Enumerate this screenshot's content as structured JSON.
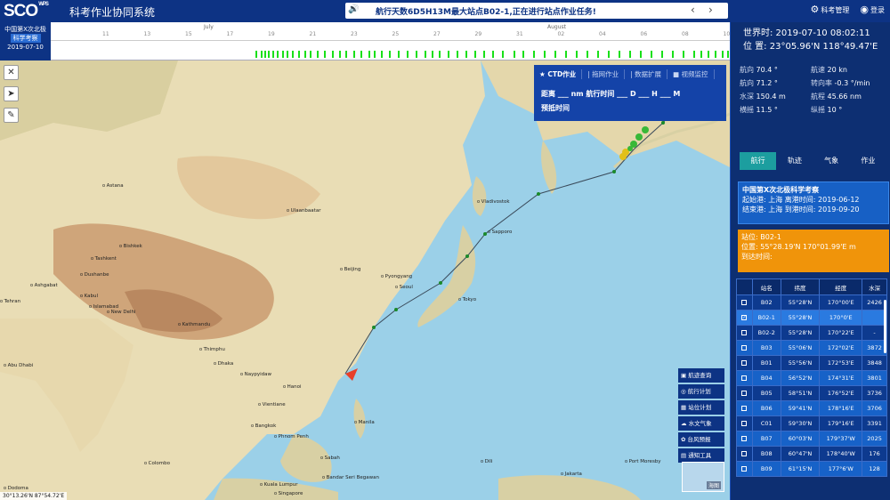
{
  "header": {
    "logo": "SCO",
    "logo_sup": "WPS",
    "app_title": "科考作业协同系统",
    "notice": "航行天数6D5H13M最大站点B02-1,正在进行站点作业任务!",
    "user_mgmt": "科考管理",
    "user": "登录"
  },
  "mission": {
    "line1": "中国第X次北极",
    "line2": "科学考察",
    "date": "2019-07-10"
  },
  "timeline": {
    "months": [
      "July",
      "August"
    ],
    "ticks": [
      "11",
      "13",
      "15",
      "17",
      "19",
      "21",
      "23",
      "25",
      "27",
      "29",
      "31",
      "02",
      "04",
      "06",
      "08",
      "10"
    ]
  },
  "popup": {
    "tabs": [
      "★ CTD作业",
      "| 拖网作业",
      "| 数据扩展",
      "■ 视频监控"
    ],
    "row1": "距离 ___ nm   航行时间 ___ D ___ H ___ M",
    "row2": "预抵时间"
  },
  "map": {
    "coord": "30°13.26'N  87°54.72'E",
    "cities": [
      "Astana",
      "Ulaanbaatar",
      "Bishkek",
      "Tashkent",
      "Dushanbe",
      "Ashgabat",
      "Tehran",
      "Kabul",
      "Islamabad",
      "New Delhi",
      "Kathmandu",
      "Dhaka",
      "Thimphu",
      "Naypyidaw",
      "Hanoi",
      "Vientiane",
      "Bangkok",
      "Phnom Penh",
      "Manila",
      "Colombo",
      "Kuala Lumpur",
      "Singapore",
      "Bandar Seri Begawan",
      "Beijing",
      "Seoul",
      "Tokyo",
      "Pyongyang",
      "Abu Dhabi",
      "Dodoma",
      "Jakarta",
      "Dili",
      "Port Moresby",
      "Sabah",
      "Vladivostok",
      "Sapporo"
    ],
    "actions": [
      "航迹查询",
      "航行计划",
      "站位计划",
      "水文气象",
      "台风预报",
      "通知工具"
    ],
    "minimap_label": "海图"
  },
  "sidebar": {
    "time": "世界时: 2019-07-10 08:02:11",
    "pos": "位  置: 23°05.96'N  118°49.47'E",
    "stats": [
      {
        "label": "航向",
        "value": "70.4 °"
      },
      {
        "label": "航速",
        "value": "20 kn"
      },
      {
        "label": "航向",
        "value": "71.2 °"
      },
      {
        "label": "转向率",
        "value": "-0.3 °/min"
      },
      {
        "label": "水深",
        "value": "150.4 m"
      },
      {
        "label": "航程",
        "value": "45.66 nm"
      },
      {
        "label": "横摇",
        "value": "11.5 °"
      },
      {
        "label": "纵摇",
        "value": "10 °"
      }
    ],
    "tabs": [
      "航行",
      "轨迹",
      "气象",
      "作业"
    ],
    "cruise": {
      "title": "中国第X次北极科学考察",
      "line2": "起始港: 上海   离港时间: 2019-06-12",
      "line3": "结束港: 上海   到港时间: 2019-09-20"
    },
    "station": {
      "line1": "站位: B02-1",
      "line2": "位置: 55°28.19'N 170°01.99'E    m",
      "line3": "到达时间:"
    },
    "table": {
      "headers": [
        "",
        "站名",
        "纬度",
        "经度",
        "水深"
      ],
      "rows": [
        [
          "B02",
          "55°28'N",
          "170°00'E",
          "2426"
        ],
        [
          "B02-1",
          "55°28'N",
          "170°0'E",
          ""
        ],
        [
          "B02-2",
          "55°28'N",
          "170°22'E",
          "-"
        ],
        [
          "B03",
          "55°06'N",
          "172°02'E",
          "3872"
        ],
        [
          "B01",
          "55°56'N",
          "172°53'E",
          "3848"
        ],
        [
          "B04",
          "56°52'N",
          "174°31'E",
          "3801"
        ],
        [
          "B05",
          "58°51'N",
          "176°52'E",
          "3736"
        ],
        [
          "B06",
          "59°41'N",
          "178°16'E",
          "3706"
        ],
        [
          "C01",
          "59°30'N",
          "179°16'E",
          "3391"
        ],
        [
          "B07",
          "60°03'N",
          "179°37'W",
          "2025"
        ],
        [
          "B08",
          "60°47'N",
          "178°40'W",
          "176"
        ],
        [
          "B09",
          "61°15'N",
          "177°6'W",
          "128"
        ]
      ]
    }
  }
}
